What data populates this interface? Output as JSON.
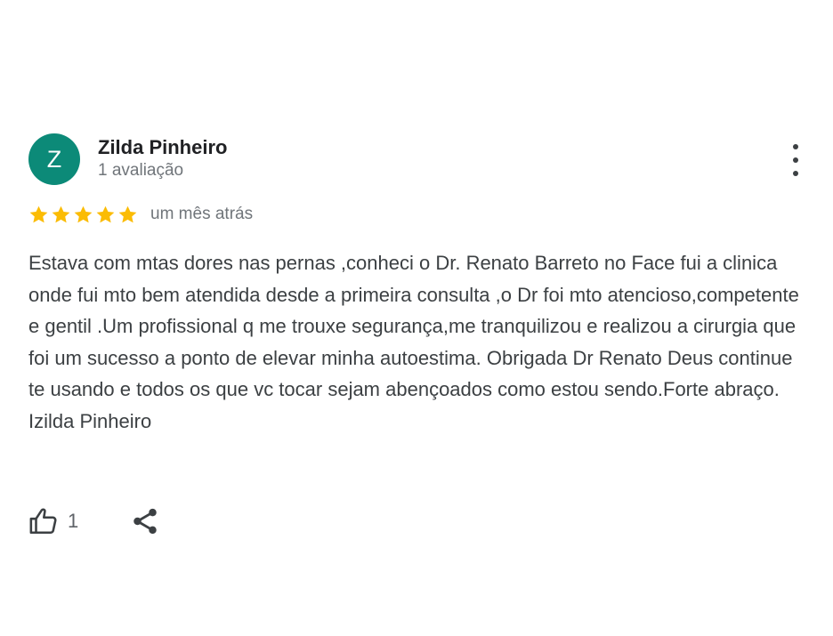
{
  "review": {
    "avatar_letter": "Z",
    "avatar_color": "#0c8a78",
    "reviewer_name": "Zilda Pinheiro",
    "reviewer_meta": "1 avaliação",
    "rating": 5,
    "rating_max": 5,
    "star_color": "#fbbc04",
    "date": "um mês atrás",
    "text": "Estava com mtas dores nas pernas ,conheci o Dr. Renato Barreto no Face fui a clinica onde fui mto bem atendida desde a primeira consulta ,o Dr foi mto atencioso,competente e gentil .Um profissional q me trouxe segurança,me tranquilizou e realizou a cirurgia que foi um sucesso a ponto de elevar minha autoestima. Obrigada Dr Renato Deus continue te usando e todos os que vc tocar sejam abençoados como estou sendo.Forte abraço.\nIzilda Pinheiro",
    "likes": "1",
    "icons": {
      "more": "more-vertical-icon",
      "like": "thumbs-up-icon",
      "share": "share-icon",
      "star": "star-icon"
    }
  }
}
